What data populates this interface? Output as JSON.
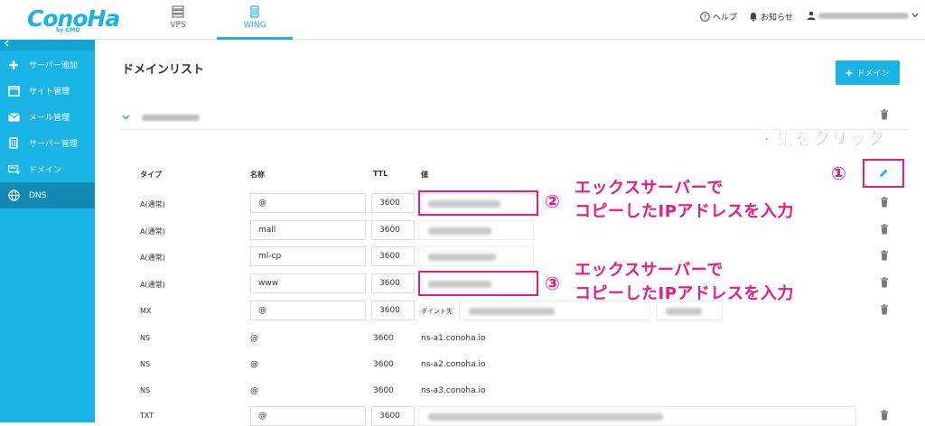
{
  "header": {
    "logo": "ConoHa",
    "logo_sub": "by GMO",
    "tabs": [
      {
        "label": "VPS"
      },
      {
        "label": "WING"
      }
    ],
    "help": "ヘルプ",
    "notice": "お知らせ"
  },
  "sidebar": {
    "collapse_icon": "chevron-left-icon",
    "items": [
      {
        "label": "サーバー追加",
        "icon": "plus-icon"
      },
      {
        "label": "サイト管理",
        "icon": "window-icon"
      },
      {
        "label": "メール管理",
        "icon": "mail-icon"
      },
      {
        "label": "サーバー管理",
        "icon": "server-icon"
      },
      {
        "label": "ドメイン",
        "icon": "domain-icon"
      },
      {
        "label": "DNS",
        "icon": "globe-icon"
      }
    ]
  },
  "main": {
    "title": "ドメインリスト",
    "add_domain_label": "ドメイン",
    "columns": {
      "type": "タイプ",
      "name": "名称",
      "ttl": "TTL",
      "value": "値"
    },
    "records": [
      {
        "type": "A(通常)",
        "name": "@",
        "ttl": "3600"
      },
      {
        "type": "A(通常)",
        "name": "mail",
        "ttl": "3600"
      },
      {
        "type": "A(通常)",
        "name": "ml-cp",
        "ttl": "3600"
      },
      {
        "type": "A(通常)",
        "name": "www",
        "ttl": "3600"
      },
      {
        "type": "MX",
        "name": "@",
        "ttl": "3600",
        "value_prefix": "ポイント先"
      },
      {
        "type": "NS",
        "name": "@",
        "ttl": "3600",
        "value": "ns-a1.conoha.io"
      },
      {
        "type": "NS",
        "name": "@",
        "ttl": "3600",
        "value": "ns-a2.conoha.io"
      },
      {
        "type": "NS",
        "name": "@",
        "ttl": "3600",
        "value": "ns-a3.conoha.io"
      },
      {
        "type": "TXT",
        "name": "@",
        "ttl": "3600"
      }
    ]
  },
  "annotations": {
    "edit_click": "編集をクリック",
    "num1": "①",
    "num2": "②",
    "num3": "③",
    "copy_line1": "エックスサーバーで",
    "copy_line2": "コピーしたIPアドレスを入力"
  },
  "colors": {
    "accent": "#19b3e6",
    "highlight": "#e8198b"
  }
}
